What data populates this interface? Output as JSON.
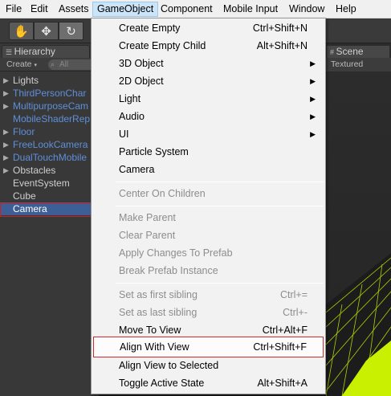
{
  "menubar": {
    "items": [
      {
        "label": "File"
      },
      {
        "label": "Edit"
      },
      {
        "label": "Assets"
      },
      {
        "label": "GameObject"
      },
      {
        "label": "Component"
      },
      {
        "label": "Mobile Input"
      },
      {
        "label": "Window"
      },
      {
        "label": "Help"
      }
    ]
  },
  "toolbar": {
    "tools": [
      {
        "icon": "hand-icon",
        "glyph": "✋"
      },
      {
        "icon": "move-icon",
        "glyph": "✥"
      },
      {
        "icon": "rotate-icon",
        "glyph": "↻"
      }
    ]
  },
  "hierarchy": {
    "tab_label": "Hierarchy",
    "create_label": "Create",
    "search_placeholder": "All",
    "items": [
      {
        "label": "Lights",
        "expandable": true,
        "prefab": false
      },
      {
        "label": "ThirdPersonChar",
        "expandable": true,
        "prefab": true
      },
      {
        "label": "MultipurposeCam",
        "expandable": true,
        "prefab": true
      },
      {
        "label": "MobileShaderRep",
        "expandable": false,
        "prefab": true
      },
      {
        "label": "Floor",
        "expandable": true,
        "prefab": true
      },
      {
        "label": "FreeLookCamera",
        "expandable": true,
        "prefab": true
      },
      {
        "label": "DualTouchMobile",
        "expandable": true,
        "prefab": true
      },
      {
        "label": "Obstacles",
        "expandable": true,
        "prefab": false
      },
      {
        "label": "EventSystem",
        "expandable": false,
        "prefab": false
      },
      {
        "label": "Cube",
        "expandable": false,
        "prefab": false
      },
      {
        "label": "Camera",
        "expandable": false,
        "prefab": false,
        "selected": true
      }
    ]
  },
  "scene": {
    "tab_label": "Scene",
    "mode_label": "Textured"
  },
  "gameobject_menu": {
    "items": [
      {
        "label": "Create Empty",
        "shortcut": "Ctrl+Shift+N"
      },
      {
        "label": "Create Empty Child",
        "shortcut": "Alt+Shift+N"
      },
      {
        "label": "3D Object",
        "submenu": true
      },
      {
        "label": "2D Object",
        "submenu": true
      },
      {
        "label": "Light",
        "submenu": true
      },
      {
        "label": "Audio",
        "submenu": true
      },
      {
        "label": "UI",
        "submenu": true
      },
      {
        "label": "Particle System"
      },
      {
        "label": "Camera"
      },
      {
        "label": "Center On Children",
        "disabled": true
      },
      {
        "label": "Make Parent",
        "disabled": true
      },
      {
        "label": "Clear Parent",
        "disabled": true
      },
      {
        "label": "Apply Changes To Prefab",
        "disabled": true
      },
      {
        "label": "Break Prefab Instance",
        "disabled": true
      },
      {
        "label": "Set as first sibling",
        "shortcut": "Ctrl+=",
        "disabled": true
      },
      {
        "label": "Set as last sibling",
        "shortcut": "Ctrl+-",
        "disabled": true
      },
      {
        "label": "Move To View",
        "shortcut": "Ctrl+Alt+F"
      },
      {
        "label": "Align With View",
        "shortcut": "Ctrl+Shift+F",
        "highlighted": true
      },
      {
        "label": "Align View to Selected"
      },
      {
        "label": "Toggle Active State",
        "shortcut": "Alt+Shift+A"
      }
    ]
  },
  "colors": {
    "prefab_text": "#5f8fd8",
    "annotation_red": "#d01f1f",
    "scene_grid": "#c8f000"
  }
}
